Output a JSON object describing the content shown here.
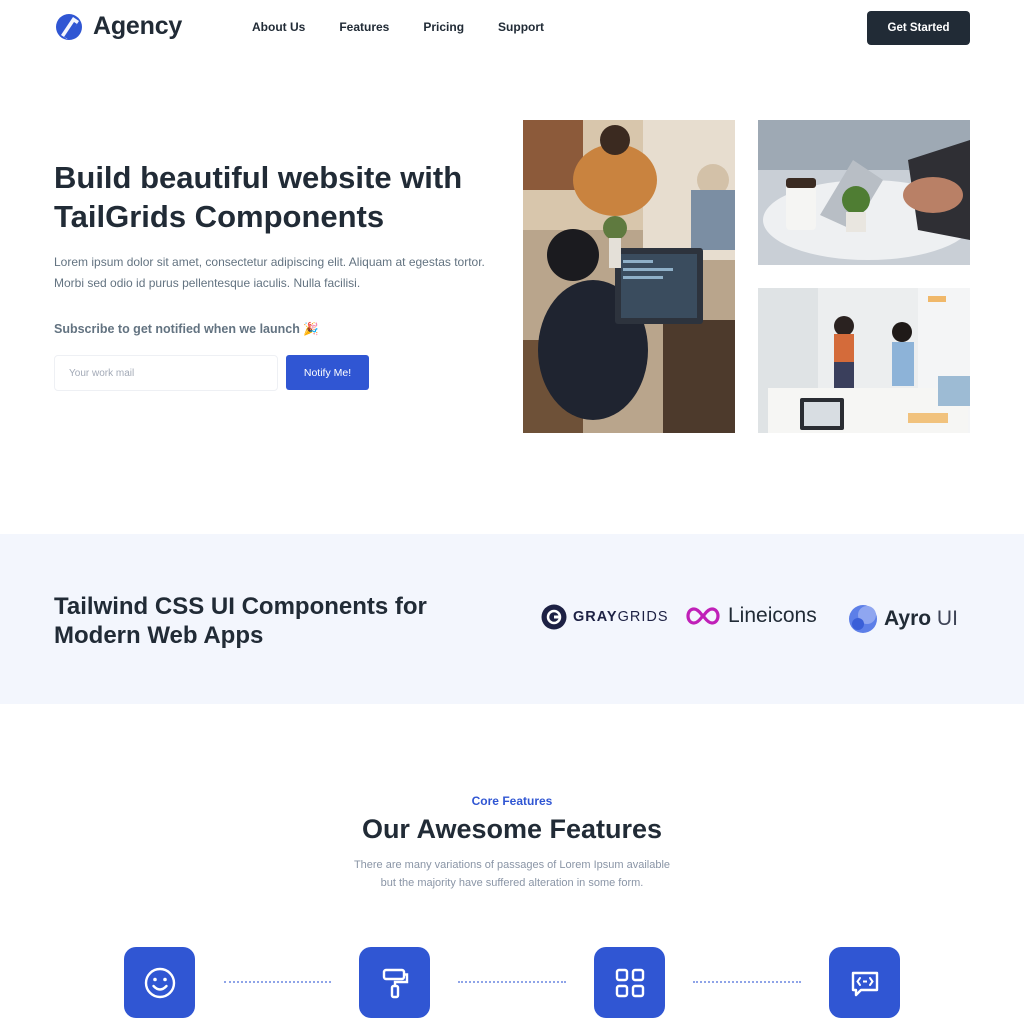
{
  "nav": {
    "logo_text": "Agency",
    "links": [
      "About Us",
      "Features",
      "Pricing",
      "Support"
    ],
    "cta_label": "Get Started"
  },
  "hero": {
    "title": "Build beautiful website with TailGrids Components",
    "description": "Lorem ipsum dolor sit amet, consectetur adipiscing elit. Aliquam at egestas tortor. Morbi sed odio id purus pellentesque iaculis. Nulla facilisi.",
    "subscribe_label": "Subscribe to get notified when we launch 🎉",
    "email_placeholder": "Your work mail",
    "notify_label": "Notify Me!"
  },
  "brands": {
    "title": "Tailwind CSS UI Components for Modern Web Apps",
    "graygrids_bold": "GRAY",
    "graygrids_light": "GRIDS",
    "lineicons": "Lineicons",
    "ayro_bold": "Ayro",
    "ayro_light": "UI"
  },
  "features": {
    "kicker": "Core Features",
    "title": "Our Awesome Features",
    "desc_line1": "There are many variations of passages of Lorem Ipsum available",
    "desc_line2": "but the majority have suffered alteration in some form.",
    "icons": [
      "smile-icon",
      "paint-roller-icon",
      "grid-icon",
      "chat-code-icon"
    ]
  },
  "colors": {
    "primary": "#3056d3",
    "dark": "#212b36",
    "band_bg": "#f3f6fd",
    "lineicons_accent": "#c020b8"
  }
}
